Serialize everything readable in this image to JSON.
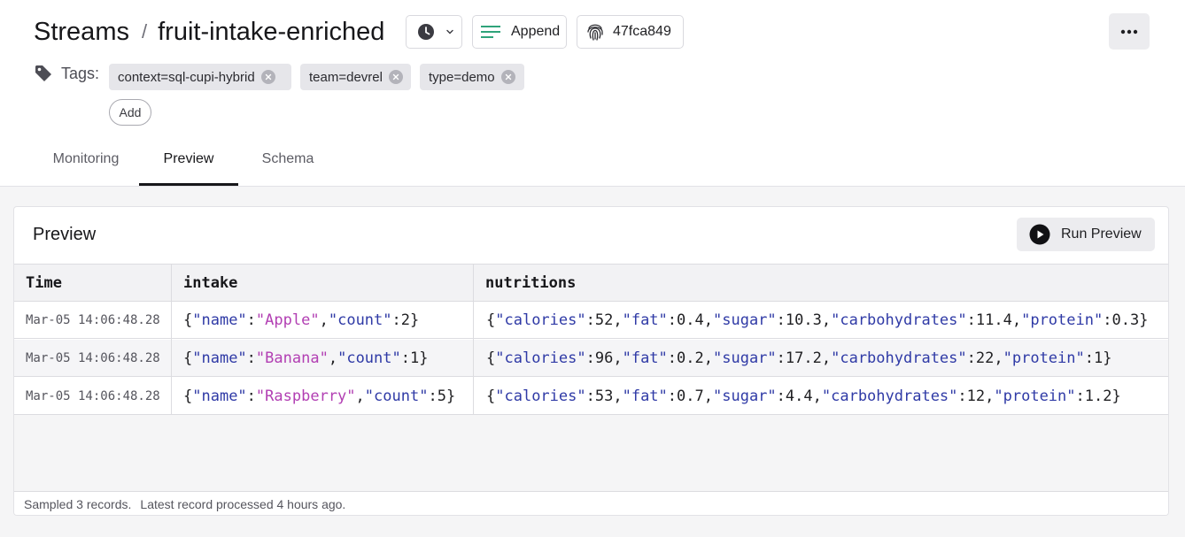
{
  "breadcrumb": {
    "root": "Streams",
    "separator": "/",
    "name": "fruit-intake-enriched"
  },
  "toolbar": {
    "mode_label": "Append",
    "version_id": "47fca849",
    "clock_icon": "clock-icon",
    "more_icon": "more-horizontal-icon"
  },
  "tags": {
    "label": "Tags:",
    "items": [
      "context=sql-cupi-hybrid",
      "team=devrel",
      "type=demo"
    ],
    "add_label": "Add"
  },
  "tabs": [
    {
      "label": "Monitoring",
      "active": false
    },
    {
      "label": "Preview",
      "active": true
    },
    {
      "label": "Schema",
      "active": false
    }
  ],
  "preview": {
    "title": "Preview",
    "run_label": "Run Preview",
    "columns": [
      "Time",
      "intake",
      "nutritions"
    ],
    "rows": [
      {
        "time": "Mar-05 14:06:48.28",
        "intake": {
          "name": "Apple",
          "count": "2"
        },
        "nutritions": {
          "calories": "52",
          "fat": "0.4",
          "sugar": "10.3",
          "carbohydrates": "11.4",
          "protein": "0.3"
        }
      },
      {
        "time": "Mar-05 14:06:48.28",
        "intake": {
          "name": "Banana",
          "count": "1"
        },
        "nutritions": {
          "calories": "96",
          "fat": "0.2",
          "sugar": "17.2",
          "carbohydrates": "22",
          "protein": "1"
        }
      },
      {
        "time": "Mar-05 14:06:48.28",
        "intake": {
          "name": "Raspberry",
          "count": "5"
        },
        "nutritions": {
          "calories": "53",
          "fat": "0.7",
          "sugar": "4.4",
          "carbohydrates": "12",
          "protein": "1.2"
        }
      }
    ],
    "footer_sampled": "Sampled 3 records.",
    "footer_latest": "Latest record processed 4 hours ago."
  },
  "colors": {
    "json_key": "#2f3aa6",
    "json_string": "#b23fb3",
    "accent_green": "#2fa37a"
  }
}
